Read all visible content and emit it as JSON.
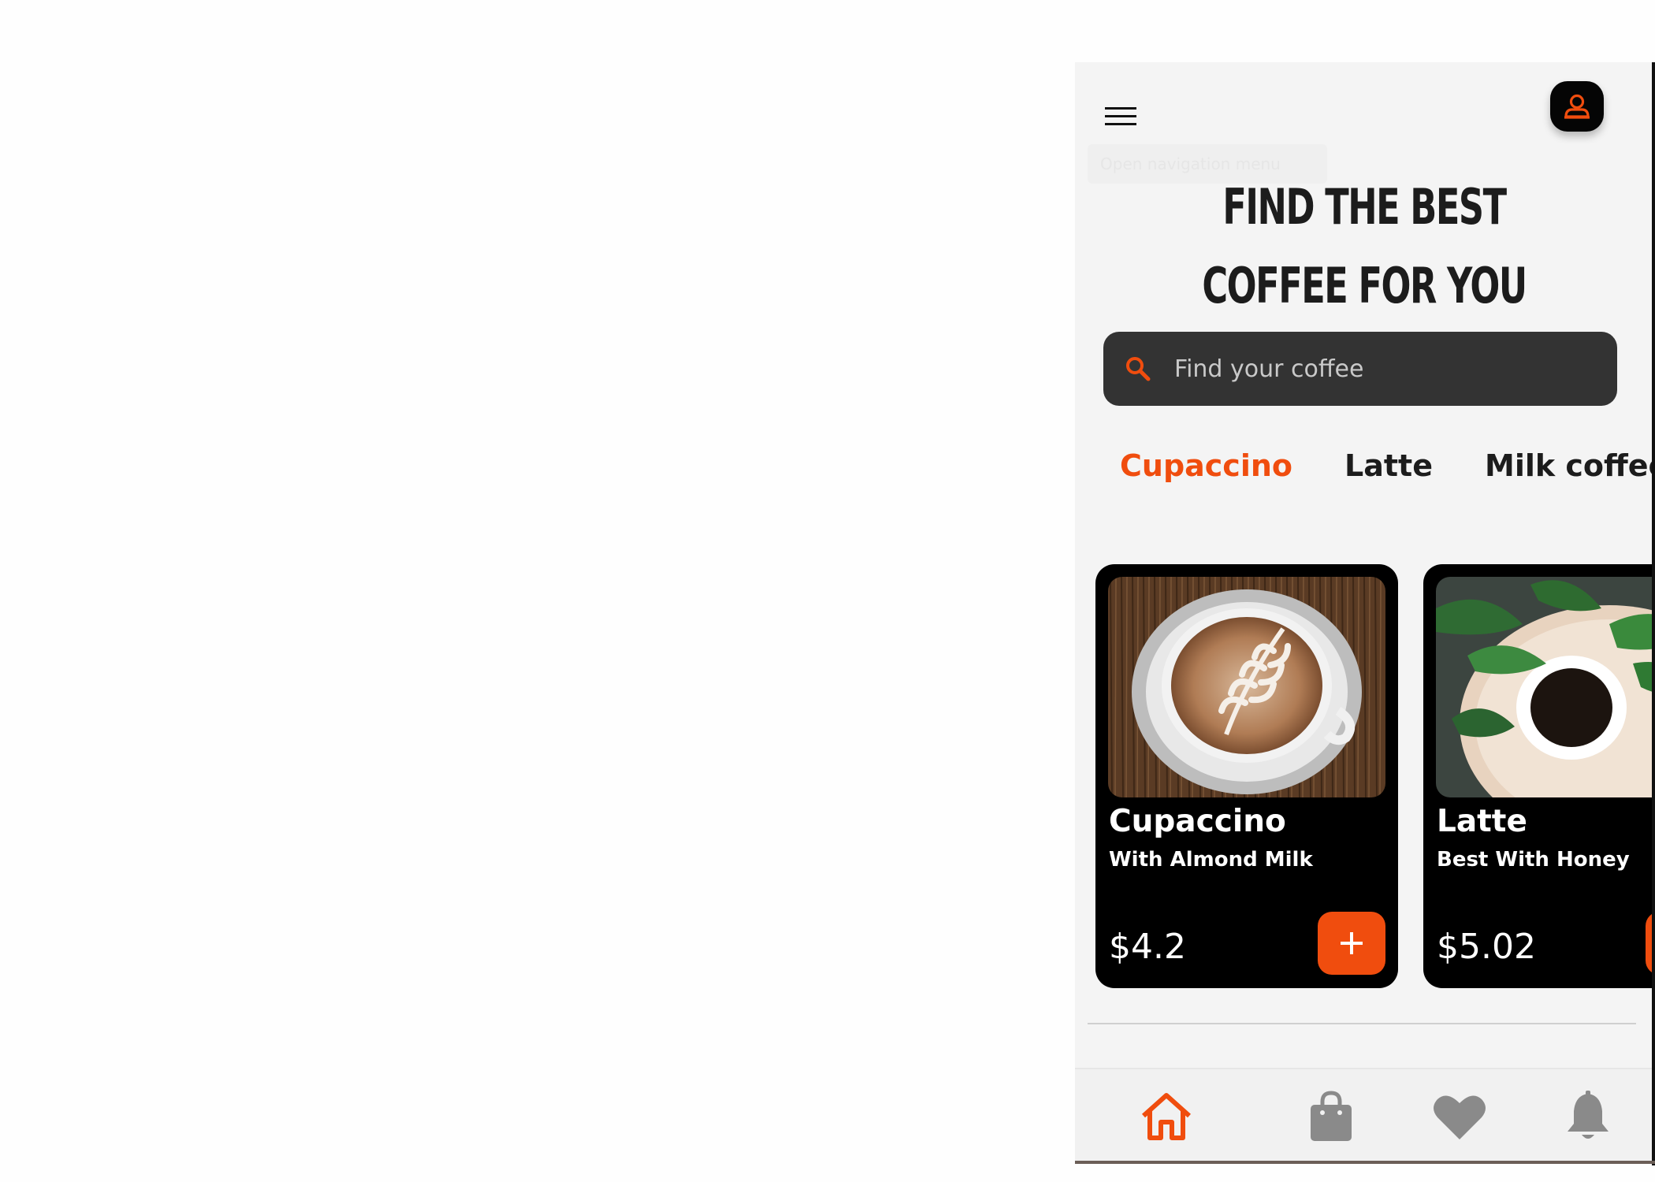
{
  "header": {
    "menu_icon": "hamburger-menu-icon",
    "tooltip": "Open navigation menu",
    "avatar_icon": "user-profile-icon"
  },
  "hero": {
    "line1": "Find the best",
    "line2": "coffee for you"
  },
  "search": {
    "icon": "search-icon",
    "placeholder": "Find your coffee"
  },
  "tabs": [
    {
      "label": "Cupaccino",
      "active": true
    },
    {
      "label": "Latte",
      "active": false
    },
    {
      "label": "Milk coffee",
      "active": false
    }
  ],
  "products": [
    {
      "name": "Cupaccino",
      "subtitle": "With Almond Milk",
      "price": "$4.2",
      "add_icon": "plus-icon"
    },
    {
      "name": "Latte",
      "subtitle": "Best With Honey",
      "price": "$5.02",
      "add_icon": "plus-icon"
    }
  ],
  "bottom_nav": [
    {
      "icon": "home-icon",
      "active": true
    },
    {
      "icon": "shopping-bag-icon",
      "active": false
    },
    {
      "icon": "heart-icon",
      "active": false
    },
    {
      "icon": "bell-icon",
      "active": false
    }
  ],
  "colors": {
    "accent": "#f04d0e",
    "background": "#f4f4f4",
    "card": "#000000",
    "search_bg": "#333333",
    "inactive_icon": "#8a8a8a"
  }
}
